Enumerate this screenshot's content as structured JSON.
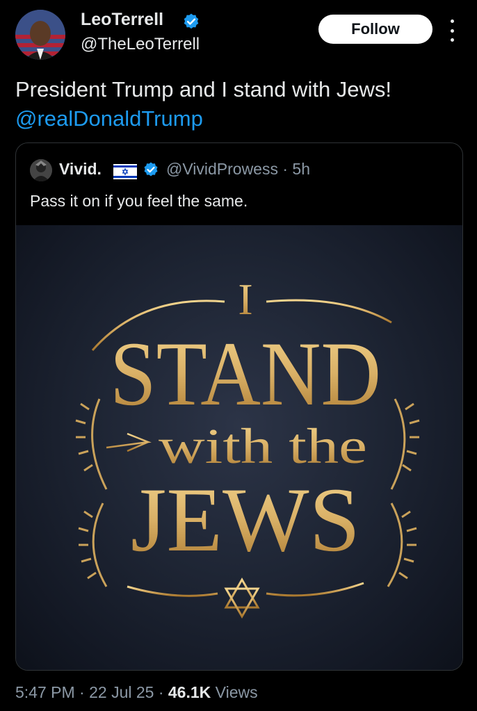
{
  "author": {
    "display_name": "LeoTerrell",
    "handle": "@TheLeoTerrell",
    "follow_label": "Follow"
  },
  "tweet": {
    "text": "President Trump and I stand with Jews!",
    "mention": "@realDonaldTrump"
  },
  "quote": {
    "display_name": "Vivid.",
    "handle_time": "@VividProwess · 5h",
    "text": "Pass it on if you feel the same.",
    "image_text": {
      "line1": "I",
      "line2": "STAND",
      "line3": "with the",
      "line4": "JEWS"
    }
  },
  "meta": {
    "time_date": "5:47 PM · 22 Jul 25 · ",
    "views_count": "46.1K",
    "views_label": " Views"
  },
  "colors": {
    "background": "#000000",
    "link": "#1d9bf0",
    "verified": "#1d9bf0",
    "muted": "#8b98a5",
    "gold": "#d9b368"
  },
  "icons": {
    "verified": "verified-badge-icon",
    "more": "more-vertical-icon",
    "flag": "israel-flag-icon",
    "star": "star-of-david-icon"
  }
}
